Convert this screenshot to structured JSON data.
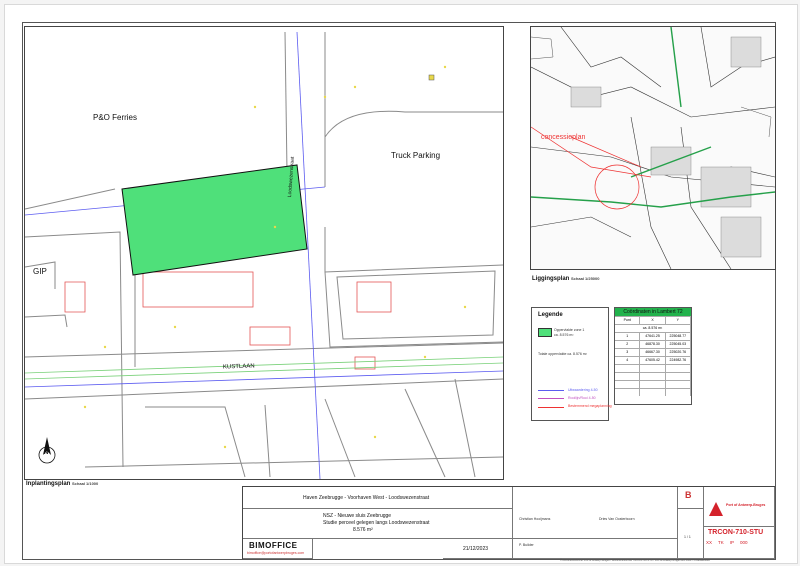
{
  "site_plan": {
    "label_pando": "P&O Ferries",
    "label_truck": "Truck Parking",
    "label_gip": "GIP",
    "label_kustlaan": "KUSTLAAN",
    "label_loodswezen": "Loodswezenstraat",
    "north_label": "N",
    "title": "Inplantingsplan",
    "scale": "Schaal 1/1000"
  },
  "location_plan": {
    "label_concessie": "concessieplan",
    "title": "Liggingsplan",
    "scale": "Schaal 1/25000"
  },
  "legend": {
    "title": "Legende",
    "item1": "Oppervlakte zone 1",
    "item1_sub": "ca. 8.576 m²",
    "total": "Totale oppervlakte ca. 8.576 m²",
    "line1": "Uitwaardering 4-50",
    "line2": "Rooilijn/Rooi 4-50",
    "line3": "Bestemmend megaplanning"
  },
  "coords": {
    "title": "Coördinaten in Lambert 72",
    "headers": [
      "Punt",
      "X",
      "Y"
    ],
    "subhdr": "ca. 8.576 m²",
    "rows": [
      [
        "1",
        "47641.25",
        "225048.77"
      ],
      [
        "2",
        "46878.30",
        "225045.03"
      ],
      [
        "3",
        "46667.30",
        "225020.76"
      ],
      [
        "4",
        "47605.42",
        "224982.76"
      ]
    ]
  },
  "title_block": {
    "project_title": "Haven Zeebrugge - Voorhaven West - Loodswezenstraat",
    "drawing_title_1": "NSZ - Nieuwe sluis Zeebrugge",
    "drawing_title_2": "Studie perceel gelegen langs Loodswezenstraat",
    "drawing_title_3": "8.576 m²",
    "logo_text": "BIMOFFICE",
    "logo_sub": "bimoffice@portofantwerpbruges.com",
    "date": "21/12/2023",
    "revision": "B",
    "person1": "Christian Hooijmans",
    "person2": "Dries Van Oosterboorn",
    "person3": "P. Builder",
    "company": "Port of Antwerp - Bruges",
    "company_short": "Port of Antwerp-Bruges",
    "doc_code": "TRCON-710-STU",
    "codes": [
      "XX",
      "TK",
      "IP",
      "000"
    ],
    "sheet": "1 / 1",
    "footer": "© Documentnummer Port of Antwerp-Bruges / Documentnummer TRCON-710-STU / Port of Antwerp Bruges ALL RIGHTS RESERVED"
  }
}
